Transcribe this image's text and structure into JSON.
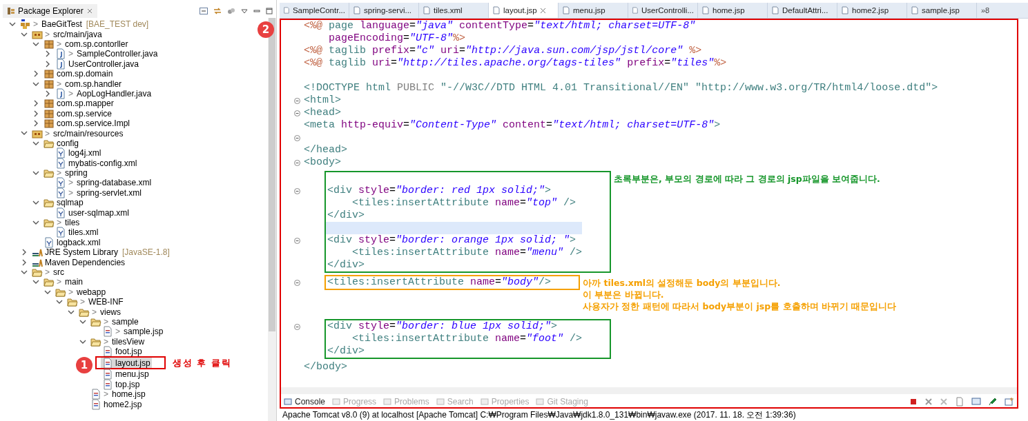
{
  "explorer": {
    "title": "Package Explorer",
    "tree": [
      {
        "label": "BaeGitTest",
        "kind": "project",
        "marker": ">",
        "decoration": "[BAE_TEST dev]",
        "expanded": true,
        "selected": false,
        "children": [
          {
            "label": "src/main/java",
            "kind": "srcfolder",
            "marker": ">",
            "expanded": true,
            "selected": false,
            "children": [
              {
                "label": "com.sp.contorller",
                "kind": "package",
                "marker": ">",
                "expanded": true,
                "selected": false,
                "children": [
                  {
                    "label": "SampleController.java",
                    "kind": "java",
                    "marker": ">",
                    "expanded": false,
                    "selected": false
                  },
                  {
                    "label": "UserController.java",
                    "kind": "java",
                    "expanded": false,
                    "selected": false
                  }
                ]
              },
              {
                "label": "com.sp.domain",
                "kind": "package",
                "expanded": false,
                "selected": false
              },
              {
                "label": "com.sp.handler",
                "kind": "package",
                "marker": ">",
                "expanded": true,
                "selected": false,
                "children": [
                  {
                    "label": "AopLogHandler.java",
                    "kind": "java",
                    "marker": ">",
                    "expanded": false,
                    "selected": false
                  }
                ]
              },
              {
                "label": "com.sp.mapper",
                "kind": "package",
                "expanded": false,
                "selected": false
              },
              {
                "label": "com.sp.service",
                "kind": "package",
                "expanded": false,
                "selected": false
              },
              {
                "label": "com.sp.service.Impl",
                "kind": "package",
                "expanded": false,
                "selected": false
              }
            ]
          },
          {
            "label": "src/main/resources",
            "kind": "srcfolder",
            "marker": ">",
            "expanded": true,
            "selected": false,
            "children": [
              {
                "label": "config",
                "kind": "folder",
                "expanded": true,
                "selected": false,
                "children": [
                  {
                    "label": "log4j.xml",
                    "kind": "xml",
                    "selected": false
                  },
                  {
                    "label": "mybatis-config.xml",
                    "kind": "xml",
                    "selected": false
                  }
                ]
              },
              {
                "label": "spring",
                "kind": "folder",
                "marker": ">",
                "expanded": true,
                "selected": false,
                "children": [
                  {
                    "label": "spring-database.xml",
                    "kind": "xml",
                    "marker": ">",
                    "selected": false
                  },
                  {
                    "label": "spring-servlet.xml",
                    "kind": "xml",
                    "marker": ">",
                    "selected": false
                  }
                ]
              },
              {
                "label": "sqlmap",
                "kind": "folder",
                "expanded": true,
                "selected": false,
                "children": [
                  {
                    "label": "user-sqlmap.xml",
                    "kind": "xml",
                    "selected": false
                  }
                ]
              },
              {
                "label": "tiles",
                "kind": "folder",
                "marker": ">",
                "expanded": true,
                "selected": false,
                "children": [
                  {
                    "label": "tiles.xml",
                    "kind": "xml",
                    "selected": false
                  }
                ]
              },
              {
                "label": "logback.xml",
                "kind": "xml",
                "selected": false
              }
            ]
          },
          {
            "label": "JRE System Library",
            "kind": "library",
            "decoration": "[JavaSE-1.8]",
            "expanded": false,
            "selected": false
          },
          {
            "label": "Maven Dependencies",
            "kind": "library",
            "expanded": false,
            "selected": false
          },
          {
            "label": "src",
            "kind": "folder",
            "marker": ">",
            "expanded": true,
            "selected": false,
            "children": [
              {
                "label": "main",
                "kind": "folder",
                "marker": ">",
                "expanded": true,
                "selected": false,
                "children": [
                  {
                    "label": "webapp",
                    "kind": "folder",
                    "marker": ">",
                    "expanded": true,
                    "selected": false,
                    "children": [
                      {
                        "label": "WEB-INF",
                        "kind": "folder",
                        "marker": ">",
                        "expanded": true,
                        "selected": false,
                        "children": [
                          {
                            "label": "views",
                            "kind": "folder",
                            "marker": ">",
                            "expanded": true,
                            "selected": false,
                            "children": [
                              {
                                "label": "sample",
                                "kind": "folder",
                                "marker": ">",
                                "expanded": true,
                                "selected": false,
                                "children": [
                                  {
                                    "label": "sample.jsp",
                                    "kind": "jsp",
                                    "marker": ">",
                                    "selected": false
                                  }
                                ]
                              },
                              {
                                "label": "tilesView",
                                "kind": "folder",
                                "marker": ">",
                                "expanded": true,
                                "selected": false,
                                "children": [
                                  {
                                    "label": "foot.jsp",
                                    "kind": "jsp",
                                    "selected": false
                                  },
                                  {
                                    "label": "layout.jsp",
                                    "kind": "jsp",
                                    "selected": true,
                                    "callout": {
                                      "badge": "1",
                                      "note": "생성 후 클릭"
                                    }
                                  },
                                  {
                                    "label": "menu.jsp",
                                    "kind": "jsp",
                                    "selected": false
                                  },
                                  {
                                    "label": "top.jsp",
                                    "kind": "jsp",
                                    "selected": false
                                  }
                                ]
                              },
                              {
                                "label": "home.jsp",
                                "kind": "jsp",
                                "marker": ">",
                                "selected": false
                              },
                              {
                                "label": "home2.jsp",
                                "kind": "jsp",
                                "selected": false
                              }
                            ]
                          }
                        ]
                      }
                    ]
                  }
                ]
              }
            ]
          }
        ]
      }
    ]
  },
  "editor_badge": "2",
  "editor_tabs": [
    {
      "label": "SampleContr...",
      "selected": false
    },
    {
      "label": "spring-servi...",
      "selected": false
    },
    {
      "label": "tiles.xml",
      "selected": false
    },
    {
      "label": "layout.jsp",
      "selected": true
    },
    {
      "label": "menu.jsp",
      "selected": false
    },
    {
      "label": "UserControlli...",
      "selected": false
    },
    {
      "label": "home.jsp",
      "selected": false
    },
    {
      "label": "DefaultAttri...",
      "selected": false
    },
    {
      "label": "home2.jsp",
      "selected": false
    },
    {
      "label": "sample.jsp",
      "selected": false
    }
  ],
  "tabs_overflow": "»8",
  "code": [
    {
      "kind": "line",
      "fold": false,
      "current": false,
      "tokens": [
        {
          "kind": "directive",
          "text": "<%@"
        },
        {
          "kind": "tag",
          "text": " page"
        },
        {
          "kind": "attr",
          "text": " language"
        },
        {
          "kind": "plain",
          "text": "="
        },
        {
          "kind": "string",
          "text": "\"java\""
        },
        {
          "kind": "attr",
          "text": " contentType"
        },
        {
          "kind": "plain",
          "text": "="
        },
        {
          "kind": "string",
          "text": "\"text/html; charset=UTF-8\""
        }
      ]
    },
    {
      "kind": "line",
      "fold": false,
      "current": false,
      "tokens": [
        {
          "kind": "attr",
          "text": "    pageEncoding"
        },
        {
          "kind": "plain",
          "text": "="
        },
        {
          "kind": "string",
          "text": "\"UTF-8\""
        },
        {
          "kind": "directive",
          "text": "%>"
        }
      ]
    },
    {
      "kind": "line",
      "fold": false,
      "current": false,
      "tokens": [
        {
          "kind": "directive",
          "text": "<%@"
        },
        {
          "kind": "tag",
          "text": " taglib"
        },
        {
          "kind": "attr",
          "text": " prefix"
        },
        {
          "kind": "plain",
          "text": "="
        },
        {
          "kind": "string",
          "text": "\"c\""
        },
        {
          "kind": "attr",
          "text": " uri"
        },
        {
          "kind": "plain",
          "text": "="
        },
        {
          "kind": "string",
          "text": "\"http://java.sun.com/jsp/jstl/core\""
        },
        {
          "kind": "directive",
          "text": " %>"
        }
      ]
    },
    {
      "kind": "line",
      "fold": false,
      "current": false,
      "tokens": [
        {
          "kind": "directive",
          "text": "<%@"
        },
        {
          "kind": "tag",
          "text": " taglib"
        },
        {
          "kind": "attr",
          "text": " uri"
        },
        {
          "kind": "plain",
          "text": "="
        },
        {
          "kind": "string",
          "text": "\"http://tiles.apache.org/tags-tiles\""
        },
        {
          "kind": "attr",
          "text": " prefix"
        },
        {
          "kind": "plain",
          "text": "="
        },
        {
          "kind": "string",
          "text": "\"tiles\""
        },
        {
          "kind": "directive",
          "text": "%>"
        }
      ]
    },
    {
      "kind": "line",
      "fold": false,
      "current": false
    },
    {
      "kind": "line",
      "fold": false,
      "current": false,
      "tokens": [
        {
          "kind": "tag",
          "text": "<!DOCTYPE html"
        },
        {
          "kind": "doctype",
          "text": " PUBLIC"
        },
        {
          "kind": "tag",
          "text": " \"-//W3C//DTD HTML 4.01 Transitional//EN\" \"http://www.w3.org/TR/html4/loose.dtd\">"
        }
      ]
    },
    {
      "kind": "line",
      "fold": true,
      "current": false,
      "tokens": [
        {
          "kind": "tag",
          "text": "<html>"
        }
      ]
    },
    {
      "kind": "line",
      "fold": true,
      "current": false,
      "tokens": [
        {
          "kind": "tag",
          "text": "<head>"
        }
      ]
    },
    {
      "kind": "line",
      "fold": false,
      "current": false,
      "tokens": [
        {
          "kind": "tag",
          "text": "<meta"
        },
        {
          "kind": "attr",
          "text": " http-equiv"
        },
        {
          "kind": "plain",
          "text": "="
        },
        {
          "kind": "string",
          "text": "\"Content-Type\""
        },
        {
          "kind": "attr",
          "text": " content"
        },
        {
          "kind": "plain",
          "text": "="
        },
        {
          "kind": "string",
          "text": "\"text/html; charset=UTF-8\""
        },
        {
          "kind": "tag",
          "text": ">"
        }
      ]
    },
    {
      "kind": "line",
      "fold": true,
      "current": false
    },
    {
      "kind": "line",
      "fold": false,
      "current": false,
      "tokens": [
        {
          "kind": "tag",
          "text": "</head>"
        }
      ]
    },
    {
      "kind": "line",
      "fold": true,
      "current": false,
      "tokens": [
        {
          "kind": "tag",
          "text": "<body>"
        }
      ]
    },
    {
      "kind": "box",
      "color": "#16962a",
      "note": [
        "초록부분은, 부모의 경로에 따라 그 경로의 jsp파일을 보여줍니다."
      ],
      "lines": [
        {
          "fold": false,
          "current": false
        },
        {
          "fold": true,
          "current": false,
          "tokens": [
            {
              "kind": "tag",
              "text": "<div"
            },
            {
              "kind": "attr",
              "text": " style"
            },
            {
              "kind": "plain",
              "text": "="
            },
            {
              "kind": "string",
              "text": "\"border: red 1px solid;\""
            },
            {
              "kind": "tag",
              "text": ">"
            }
          ]
        },
        {
          "fold": false,
          "current": false,
          "tokens": [
            {
              "kind": "tag",
              "text": "    <tiles:insertAttribute"
            },
            {
              "kind": "attr",
              "text": " name"
            },
            {
              "kind": "plain",
              "text": "="
            },
            {
              "kind": "string",
              "text": "\"top\""
            },
            {
              "kind": "tag",
              "text": " />"
            }
          ]
        },
        {
          "fold": false,
          "current": false,
          "tokens": [
            {
              "kind": "tag",
              "text": "</div>"
            }
          ]
        },
        {
          "fold": false,
          "current": true
        },
        {
          "fold": true,
          "current": false,
          "tokens": [
            {
              "kind": "tag",
              "text": "<div"
            },
            {
              "kind": "attr",
              "text": " style"
            },
            {
              "kind": "plain",
              "text": "="
            },
            {
              "kind": "string",
              "text": "\"border: orange 1px solid; \""
            },
            {
              "kind": "tag",
              "text": ">"
            }
          ]
        },
        {
          "fold": false,
          "current": false,
          "tokens": [
            {
              "kind": "tag",
              "text": "    <tiles:insertAttribute"
            },
            {
              "kind": "attr",
              "text": " name"
            },
            {
              "kind": "plain",
              "text": "="
            },
            {
              "kind": "string",
              "text": "\"menu\""
            },
            {
              "kind": "tag",
              "text": " />"
            }
          ]
        },
        {
          "fold": false,
          "current": false,
          "tokens": [
            {
              "kind": "tag",
              "text": "</div>"
            }
          ]
        }
      ]
    },
    {
      "kind": "box",
      "color": "#f5a000",
      "note": [
        "아까 tiles.xml의 설정해둔 body의 부분입니다.",
        "이 부분은 바뀝니다.",
        "사용자가 정한 패턴에 따라서 body부분이 jsp를 호출하며 바뀌기 때문입니다"
      ],
      "lines": [
        {
          "fold": true,
          "current": false,
          "tokens": [
            {
              "kind": "tag",
              "text": "<tiles:insertAttribute"
            },
            {
              "kind": "attr",
              "text": " name"
            },
            {
              "kind": "plain",
              "text": "="
            },
            {
              "kind": "string",
              "text": "\"body\""
            },
            {
              "kind": "tag",
              "text": "/>"
            }
          ]
        }
      ]
    },
    {
      "kind": "line",
      "fold": false,
      "current": false
    },
    {
      "kind": "line",
      "fold": false,
      "current": false
    },
    {
      "kind": "box",
      "color": "#16962a",
      "lines": [
        {
          "fold": true,
          "current": false,
          "tokens": [
            {
              "kind": "tag",
              "text": "<div"
            },
            {
              "kind": "attr",
              "text": " style"
            },
            {
              "kind": "plain",
              "text": "="
            },
            {
              "kind": "string",
              "text": "\"border: blue 1px solid;\""
            },
            {
              "kind": "tag",
              "text": ">"
            }
          ]
        },
        {
          "fold": false,
          "current": false,
          "tokens": [
            {
              "kind": "tag",
              "text": "    <tiles:insertAttribute"
            },
            {
              "kind": "attr",
              "text": " name"
            },
            {
              "kind": "plain",
              "text": "="
            },
            {
              "kind": "string",
              "text": "\"foot\""
            },
            {
              "kind": "tag",
              "text": " />"
            }
          ]
        },
        {
          "fold": false,
          "current": false,
          "tokens": [
            {
              "kind": "tag",
              "text": "</div>"
            }
          ]
        }
      ]
    },
    {
      "kind": "line",
      "fold": false,
      "current": false,
      "tokens": [
        {
          "kind": "tag",
          "text": "</body>"
        }
      ]
    }
  ],
  "console_tabs": [
    {
      "label": "Console",
      "selected": true
    },
    {
      "label": "Progress",
      "selected": false
    },
    {
      "label": "Problems",
      "selected": false
    },
    {
      "label": "Search",
      "selected": false
    },
    {
      "label": "Properties",
      "selected": false
    },
    {
      "label": "Git Staging",
      "selected": false
    }
  ],
  "status_bar": "Apache Tomcat v8.0 (9) at localhost [Apache Tomcat] C:₩Program Files₩Java₩jdk1.8.0_131₩bin₩javaw.exe (2017. 11. 18. 오전 1:39:36)"
}
